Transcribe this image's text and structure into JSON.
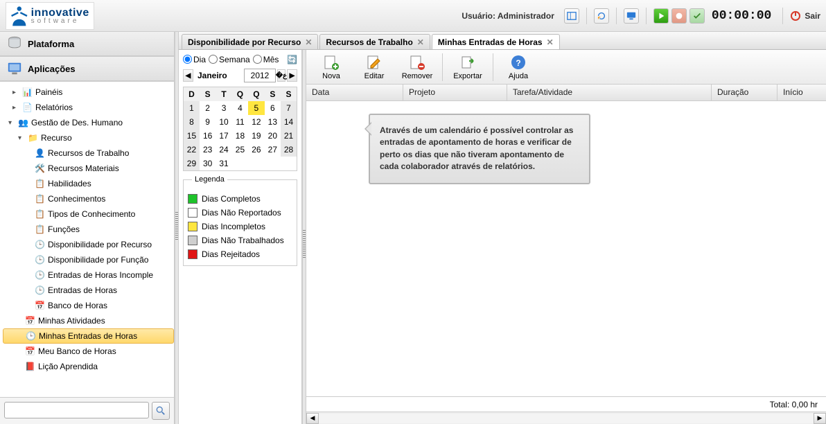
{
  "header": {
    "brand_top": "innovative",
    "brand_sub": "software",
    "user_label": "Usuário: Administrador",
    "timer": "00:00:00",
    "logout": "Sair"
  },
  "sidebar": {
    "section_platform": "Plataforma",
    "section_apps": "Aplicações",
    "nodes": {
      "paineis": "Painéis",
      "relatorios": "Relatórios",
      "gestao": "Gestão de Des. Humano",
      "recurso": "Recurso",
      "rec_trab": "Recursos de Trabalho",
      "rec_mat": "Recursos Materiais",
      "habilidades": "Habilidades",
      "conhecimentos": "Conhecimentos",
      "tipos_conh": "Tipos de Conhecimento",
      "funcoes": "Funções",
      "disp_rec": "Disponibilidade por Recurso",
      "disp_fun": "Disponibilidade por Função",
      "entradas_inc": "Entradas de Horas Incomple",
      "entradas": "Entradas de Horas",
      "banco": "Banco de Horas",
      "minhas_ativ": "Minhas Atividades",
      "minhas_entradas": "Minhas Entradas de Horas",
      "meu_banco": "Meu Banco de Horas",
      "licao": "Lição Aprendida"
    },
    "search_placeholder": ""
  },
  "tabs": [
    {
      "label": "Disponibilidade por Recurso",
      "active": false
    },
    {
      "label": "Recursos de Trabalho",
      "active": false
    },
    {
      "label": "Minhas Entradas de Horas",
      "active": true
    }
  ],
  "cal": {
    "radios": {
      "dia": "Dia",
      "semana": "Semana",
      "mes": "Mês"
    },
    "month": "Janeiro",
    "year": "2012",
    "weekdays": [
      "D",
      "S",
      "T",
      "Q",
      "Q",
      "S",
      "S"
    ],
    "weeks": [
      [
        {
          "d": 1,
          "c": "grey"
        },
        {
          "d": 2
        },
        {
          "d": 3
        },
        {
          "d": 4
        },
        {
          "d": 5,
          "c": "yellow"
        },
        {
          "d": 6
        },
        {
          "d": 7,
          "c": "grey"
        }
      ],
      [
        {
          "d": 8,
          "c": "grey"
        },
        {
          "d": 9
        },
        {
          "d": 10
        },
        {
          "d": 11
        },
        {
          "d": 12
        },
        {
          "d": 13
        },
        {
          "d": 14,
          "c": "grey"
        }
      ],
      [
        {
          "d": 15,
          "c": "grey"
        },
        {
          "d": 16
        },
        {
          "d": 17
        },
        {
          "d": 18
        },
        {
          "d": 19
        },
        {
          "d": 20
        },
        {
          "d": 21,
          "c": "grey"
        }
      ],
      [
        {
          "d": 22,
          "c": "grey"
        },
        {
          "d": 23
        },
        {
          "d": 24
        },
        {
          "d": 25
        },
        {
          "d": 26
        },
        {
          "d": 27
        },
        {
          "d": 28,
          "c": "grey"
        }
      ],
      [
        {
          "d": 29,
          "c": "grey"
        },
        {
          "d": 30
        },
        {
          "d": 31
        },
        {
          "d": "",
          "c": ""
        },
        {
          "d": "",
          "c": ""
        },
        {
          "d": "",
          "c": ""
        },
        {
          "d": "",
          "c": ""
        }
      ]
    ],
    "legend_title": "Legenda",
    "legend": [
      {
        "color": "#1ec32b",
        "label": "Dias Completos"
      },
      {
        "color": "#ffffff",
        "label": "Dias Não Reportados"
      },
      {
        "color": "#ffe640",
        "label": "Dias Incompletos"
      },
      {
        "color": "#cfcfcf",
        "label": "Dias Não Trabalhados"
      },
      {
        "color": "#e01515",
        "label": "Dias Rejeitados"
      }
    ]
  },
  "toolbar": {
    "nova": "Nova",
    "editar": "Editar",
    "remover": "Remover",
    "exportar": "Exportar",
    "ajuda": "Ajuda"
  },
  "grid": {
    "cols": {
      "data": "Data",
      "projeto": "Projeto",
      "tarefa": "Tarefa/Atividade",
      "duracao": "Duração",
      "inicio": "Início"
    },
    "tooltip": "Através de um calendário é possível controlar as entradas de apontamento de horas e verificar de perto os dias que não tiveram apontamento de cada colaborador através de relatórios.",
    "footer": "Total: 0,00 hr"
  }
}
